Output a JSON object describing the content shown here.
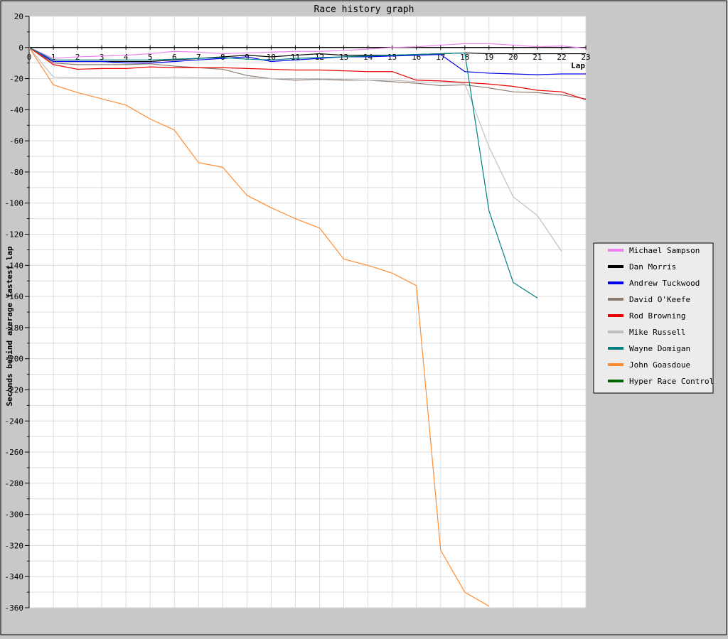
{
  "chart_data": {
    "type": "line",
    "title": "Race history graph",
    "xlabel": "Lap",
    "ylabel": "Seconds behind average fastest lap",
    "xlim": [
      0,
      23
    ],
    "ylim": [
      -360,
      20
    ],
    "x_ticks": [
      0,
      1,
      2,
      3,
      4,
      5,
      6,
      7,
      8,
      9,
      10,
      11,
      12,
      13,
      14,
      15,
      16,
      17,
      18,
      19,
      20,
      21,
      22,
      23
    ],
    "x_tick_labels": [
      "0",
      "1",
      "2",
      "3",
      "4",
      "5",
      "6",
      "7",
      "8",
      "9",
      "10",
      "11",
      "12",
      "13",
      "14",
      "15",
      "16",
      "17",
      "18",
      "19",
      "20",
      "21",
      "22",
      "23"
    ],
    "y_ticks": [
      20,
      0,
      -20,
      -40,
      -60,
      -80,
      -100,
      -120,
      -140,
      -160,
      -180,
      -200,
      -220,
      -240,
      -260,
      -280,
      -300,
      -320,
      -340,
      -360
    ],
    "y_tick_labels": [
      "20",
      "0",
      "-20",
      "-40",
      "-60",
      "-80",
      "-100",
      "-120",
      "-140",
      "-160",
      "-180",
      "-200",
      "-220",
      "-240",
      "-260",
      "-280",
      "-300",
      "-320",
      "-340",
      "-360"
    ],
    "grid": true,
    "legend_position": "right",
    "series": [
      {
        "name": "Michael Sampson",
        "color": "#ee82ee",
        "x": [
          0,
          1,
          2,
          3,
          4,
          5,
          6,
          7,
          8,
          9,
          10,
          11,
          12,
          13,
          14,
          15,
          16,
          17,
          18,
          19,
          20,
          21,
          22,
          23
        ],
        "y": [
          0,
          -7,
          -6,
          -5.5,
          -5,
          -4,
          -2.5,
          -3,
          -4,
          -3.5,
          -3,
          -2.5,
          -2.5,
          -2,
          -1,
          0,
          0.5,
          1.5,
          2.5,
          2.5,
          1.5,
          0.5,
          1,
          -0.5
        ]
      },
      {
        "name": "Dan Morris",
        "color": "#000000",
        "x": [
          0,
          1,
          2,
          3,
          4,
          5,
          6,
          7,
          8,
          9,
          10,
          11,
          12,
          13,
          14,
          15,
          16,
          17,
          18,
          19,
          20,
          21,
          22,
          23
        ],
        "y": [
          0,
          -9,
          -9,
          -9,
          -9,
          -9,
          -8,
          -7,
          -6,
          -5,
          -6,
          -5,
          -4,
          -5,
          -5,
          -5,
          -4.5,
          -4,
          -3.5,
          -4,
          -4,
          -4,
          -4,
          -4
        ]
      },
      {
        "name": "Andrew Tuckwood",
        "color": "#0000ee",
        "x": [
          0,
          1,
          2,
          3,
          4,
          5,
          6,
          7,
          8,
          9,
          10,
          11,
          12,
          13,
          14,
          15,
          16,
          17,
          18,
          19,
          20,
          21,
          22,
          23
        ],
        "y": [
          0,
          -9,
          -9,
          -9,
          -10,
          -10,
          -9,
          -8,
          -7,
          -6,
          -9,
          -8,
          -7,
          -6,
          -6,
          -5.5,
          -5,
          -4.5,
          -15.5,
          -16.5,
          -17,
          -17.5,
          -17,
          -17
        ]
      },
      {
        "name": "David O'Keefe",
        "color": "#8b7b70",
        "x": [
          0,
          1,
          2,
          3,
          4,
          5,
          6,
          7,
          8,
          9,
          10,
          11,
          12,
          13,
          14,
          15,
          16,
          17,
          18,
          19,
          20,
          21,
          22,
          23
        ],
        "y": [
          0,
          -10,
          -11,
          -11,
          -11,
          -10.5,
          -12,
          -13,
          -14,
          -18,
          -20,
          -21,
          -20.5,
          -21,
          -21,
          -22,
          -23,
          -24.5,
          -24,
          -26,
          -28.5,
          -29,
          -30.5,
          -33
        ]
      },
      {
        "name": "Rod Browning",
        "color": "#ee0000",
        "x": [
          0,
          1,
          2,
          3,
          4,
          5,
          6,
          7,
          8,
          9,
          10,
          11,
          12,
          13,
          14,
          15,
          16,
          17,
          18,
          19,
          20,
          21,
          22,
          23
        ],
        "y": [
          0,
          -11,
          -14,
          -13.5,
          -13.5,
          -12.5,
          -13,
          -13,
          -13,
          -13.5,
          -14,
          -14.5,
          -14.5,
          -15,
          -15.5,
          -15.5,
          -21,
          -21.5,
          -22.5,
          -23.5,
          -25,
          -27.5,
          -28.5,
          -33.5
        ]
      },
      {
        "name": "Mike Russell",
        "color": "#c0c0c0",
        "x": [
          0,
          1,
          2,
          3,
          4,
          5,
          6,
          7,
          8,
          9,
          10,
          11,
          12,
          13,
          14,
          15,
          16,
          17,
          18,
          19,
          20,
          21,
          22
        ],
        "y": [
          0,
          -19,
          -19.5,
          -19.5,
          -19.5,
          -19.5,
          -19,
          -19.5,
          -19.5,
          -19.5,
          -20,
          -20,
          -20,
          -20.5,
          -21,
          -21,
          -22,
          -22.5,
          -23,
          -64,
          -96,
          -108,
          -131
        ]
      },
      {
        "name": "Wayne Domigan",
        "color": "#008080",
        "x": [
          0,
          1,
          2,
          3,
          4,
          5,
          6,
          7,
          8,
          9,
          10,
          11,
          12,
          13,
          14,
          15,
          16,
          17,
          18,
          19,
          20,
          21
        ],
        "y": [
          0,
          -8,
          -8,
          -8,
          -8,
          -8,
          -7.5,
          -7,
          -6.5,
          -7.5,
          -8,
          -7,
          -6.5,
          -6,
          -5.5,
          -5,
          -4.5,
          -4,
          -3.5,
          -105,
          -151,
          -161
        ]
      },
      {
        "name": "John Goasdoue",
        "color": "#ff8c33",
        "x": [
          0,
          1,
          2,
          3,
          4,
          5,
          6,
          7,
          8,
          9,
          10,
          11,
          12,
          13,
          14,
          15,
          16,
          17,
          18,
          19
        ],
        "y": [
          0,
          -24,
          -29,
          -33,
          -37,
          -46,
          -53,
          -74,
          -77,
          -95,
          -103,
          -110,
          -116,
          -136,
          -140,
          -145,
          -153,
          -323,
          -350,
          -359
        ]
      },
      {
        "name": "Hyper Race Control",
        "color": "#006400",
        "x": [],
        "y": []
      }
    ]
  }
}
